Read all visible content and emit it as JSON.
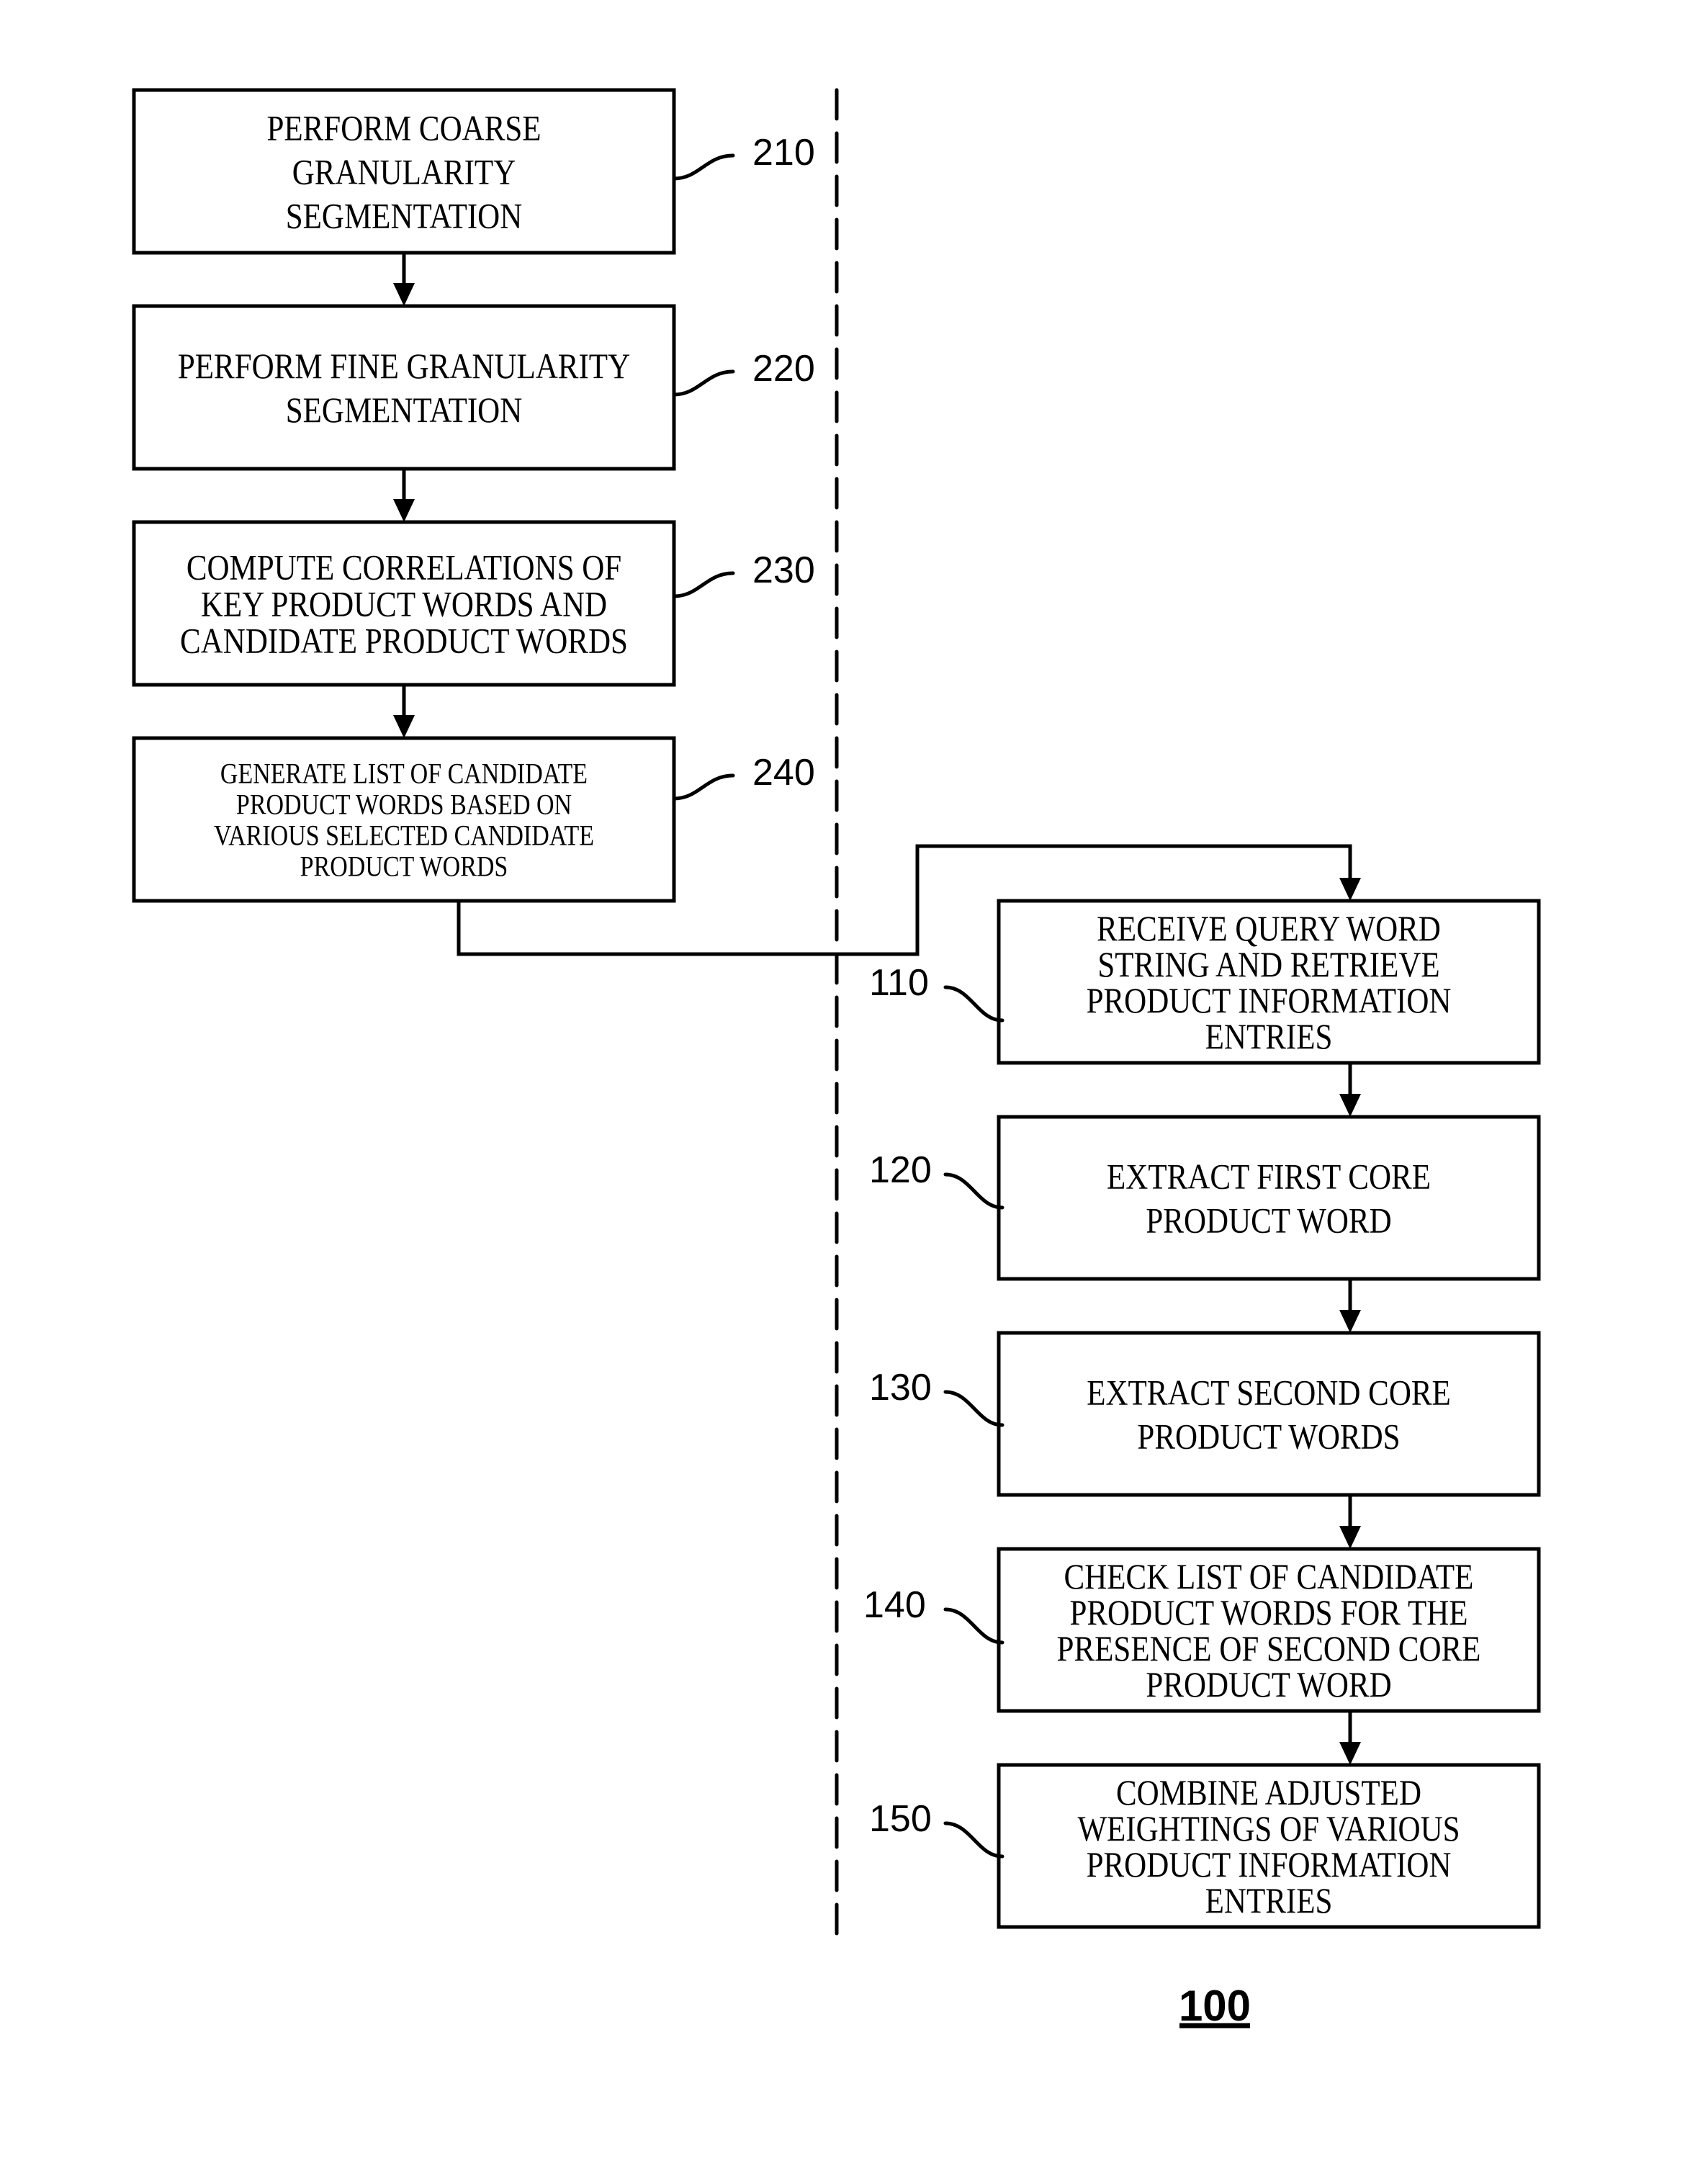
{
  "figure": {
    "number": "100",
    "title_underlined": true
  },
  "left_column": {
    "steps": [
      {
        "ref": "210",
        "lines": [
          "PERFORM COARSE",
          "GRANULARITY",
          "SEGMENTATION"
        ]
      },
      {
        "ref": "220",
        "lines": [
          "PERFORM FINE GRANULARITY",
          "SEGMENTATION"
        ]
      },
      {
        "ref": "230",
        "lines": [
          "COMPUTE CORRELATIONS OF",
          "KEY PRODUCT WORDS AND",
          "CANDIDATE PRODUCT WORDS"
        ]
      },
      {
        "ref": "240",
        "lines": [
          "GENERATE LIST OF CANDIDATE",
          "PRODUCT WORDS BASED ON",
          "VARIOUS SELECTED CANDIDATE",
          "PRODUCT WORDS"
        ]
      }
    ]
  },
  "right_column": {
    "steps": [
      {
        "ref": "110",
        "lines": [
          "RECEIVE QUERY WORD",
          "STRING AND RETRIEVE",
          "PRODUCT INFORMATION",
          "ENTRIES"
        ]
      },
      {
        "ref": "120",
        "lines": [
          "EXTRACT FIRST CORE",
          "PRODUCT WORD"
        ]
      },
      {
        "ref": "130",
        "lines": [
          "EXTRACT SECOND CORE",
          "PRODUCT WORDS"
        ]
      },
      {
        "ref": "140",
        "lines": [
          "CHECK LIST OF CANDIDATE",
          "PRODUCT WORDS FOR THE",
          "PRESENCE OF SECOND CORE",
          "PRODUCT WORD"
        ]
      },
      {
        "ref": "150",
        "lines": [
          "COMBINE ADJUSTED",
          "WEIGHTINGS OF VARIOUS",
          "PRODUCT INFORMATION",
          "ENTRIES"
        ]
      }
    ]
  },
  "connections": [
    {
      "from": "210",
      "to": "220"
    },
    {
      "from": "220",
      "to": "230"
    },
    {
      "from": "230",
      "to": "240"
    },
    {
      "from": "240",
      "to": "110"
    },
    {
      "from": "110",
      "to": "120"
    },
    {
      "from": "120",
      "to": "130"
    },
    {
      "from": "130",
      "to": "140"
    },
    {
      "from": "140",
      "to": "150"
    }
  ],
  "colors": {
    "line": "#000000",
    "background": "#ffffff"
  }
}
